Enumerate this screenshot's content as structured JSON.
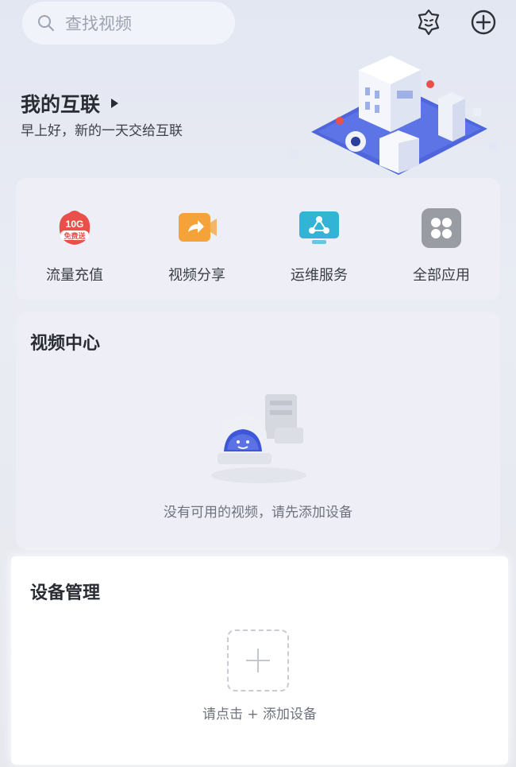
{
  "search": {
    "placeholder": "查找视频"
  },
  "topbar": {
    "scan_icon": "face-scan-icon",
    "add_icon": "plus-circle-icon"
  },
  "header": {
    "title": "我的互联",
    "greeting": "早上好，新的一天交给互联"
  },
  "apps": [
    {
      "label": "流量充值",
      "icon": "data-recharge-icon",
      "badge_top": "10G",
      "badge_bottom": "免费送"
    },
    {
      "label": "视频分享",
      "icon": "video-share-icon"
    },
    {
      "label": "运维服务",
      "icon": "ops-service-icon"
    },
    {
      "label": "全部应用",
      "icon": "all-apps-icon"
    }
  ],
  "video_center": {
    "title": "视频中心",
    "empty_text": "没有可用的视频，请先添加设备"
  },
  "device_management": {
    "title": "设备管理",
    "add_hint": "请点击 + 添加设备"
  },
  "colors": {
    "accent_blue": "#3e57d8",
    "orange": "#f3a33a",
    "red": "#e9504a",
    "teal": "#33b3d6",
    "gray": "#9a9ca3"
  }
}
